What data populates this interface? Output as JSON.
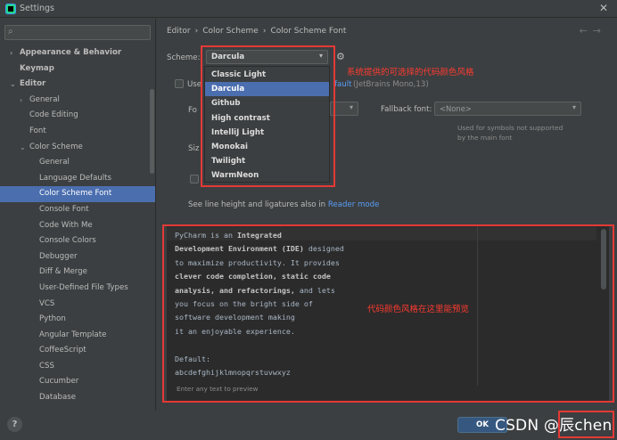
{
  "window": {
    "title": "Settings",
    "close_glyph": "✕",
    "icon": "settings-app-icon"
  },
  "search": {
    "placeholder": "",
    "icon": "search-icon"
  },
  "sidebar": {
    "items": [
      {
        "label": "Appearance & Behavior",
        "bold": true,
        "arrow": "›"
      },
      {
        "label": "Keymap",
        "bold": true,
        "arrow": ""
      },
      {
        "label": "Editor",
        "bold": true,
        "arrow": "⌄"
      },
      {
        "label": "General",
        "bold": false,
        "arrow": "›"
      },
      {
        "label": "Code Editing",
        "bold": false,
        "arrow": ""
      },
      {
        "label": "Font",
        "bold": false,
        "arrow": ""
      },
      {
        "label": "Color Scheme",
        "bold": false,
        "arrow": "⌄"
      },
      {
        "label": "General",
        "bold": false,
        "arrow": ""
      },
      {
        "label": "Language Defaults",
        "bold": false,
        "arrow": ""
      },
      {
        "label": "Color Scheme Font",
        "bold": false,
        "arrow": "",
        "selected": true
      },
      {
        "label": "Console Font",
        "bold": false,
        "arrow": ""
      },
      {
        "label": "Code With Me",
        "bold": false,
        "arrow": ""
      },
      {
        "label": "Console Colors",
        "bold": false,
        "arrow": ""
      },
      {
        "label": "Debugger",
        "bold": false,
        "arrow": ""
      },
      {
        "label": "Diff & Merge",
        "bold": false,
        "arrow": ""
      },
      {
        "label": "User-Defined File Types",
        "bold": false,
        "arrow": ""
      },
      {
        "label": "VCS",
        "bold": false,
        "arrow": ""
      },
      {
        "label": "Python",
        "bold": false,
        "arrow": ""
      },
      {
        "label": "Angular Template",
        "bold": false,
        "arrow": ""
      },
      {
        "label": "CoffeeScript",
        "bold": false,
        "arrow": ""
      },
      {
        "label": "CSS",
        "bold": false,
        "arrow": ""
      },
      {
        "label": "Cucumber",
        "bold": false,
        "arrow": ""
      },
      {
        "label": "Database",
        "bold": false,
        "arrow": ""
      }
    ]
  },
  "breadcrumb": {
    "items": [
      "Editor",
      "Color Scheme",
      "Color Scheme Font"
    ],
    "back": "←",
    "forward": "→"
  },
  "scheme": {
    "label": "Scheme:",
    "value": "Darcula",
    "options": [
      "Classic Light",
      "Darcula",
      "Github",
      "High contrast",
      "IntelliJ Light",
      "Monokai",
      "Twilight",
      "WarmNeon"
    ],
    "selected": "Darcula"
  },
  "use_font": {
    "label_partial": "Use",
    "link_partial": "fault",
    "font_info": "(JetBrains Mono,13)"
  },
  "font_row": {
    "label_partial": "Fo",
    "size_label_partial": "Siz"
  },
  "fallback": {
    "label": "Fallback font:",
    "value": "<None>",
    "note": "Used for symbols not supported by the main font"
  },
  "reader_mode": {
    "text": "See line height and ligatures also in",
    "link": "Reader mode"
  },
  "preview": {
    "lines": [
      [
        {
          "t": "PyCharm is an ",
          "b": false
        },
        {
          "t": "Integrated",
          "b": true
        }
      ],
      [
        {
          "t": "Development Environment (IDE)",
          "b": true
        },
        {
          "t": " designed",
          "b": false
        }
      ],
      [
        {
          "t": "to maximize productivity. It provides",
          "b": false
        }
      ],
      [
        {
          "t": "clever code completion, static code",
          "b": true
        }
      ],
      [
        {
          "t": "analysis, and refactorings,",
          "b": true
        },
        {
          "t": " and lets",
          "b": false
        }
      ],
      [
        {
          "t": "you focus on the bright side of",
          "b": false
        }
      ],
      [
        {
          "t": "software development making",
          "b": false
        }
      ],
      [
        {
          "t": "it an enjoyable experience.",
          "b": false
        }
      ],
      [
        {
          "t": "",
          "b": false
        }
      ],
      [
        {
          "t": "Default:",
          "b": false
        }
      ],
      [
        {
          "t": "abcdefghijklmnopqrstuvwxyz",
          "b": false
        }
      ]
    ],
    "hint": "Enter any text to preview"
  },
  "buttons": {
    "ok": "OK",
    "help": "?"
  },
  "annotations": {
    "dropdown_note": "系统提供的可选择的代码颜色风格",
    "preview_note": "代码颜色风格在这里能预览",
    "color": "#e53935"
  },
  "watermark": "CSDN @辰chen",
  "colors": {
    "background": "#3c3f41",
    "selection": "#4b6eaf",
    "editor_bg": "#2b2b2b",
    "link": "#589df6"
  }
}
